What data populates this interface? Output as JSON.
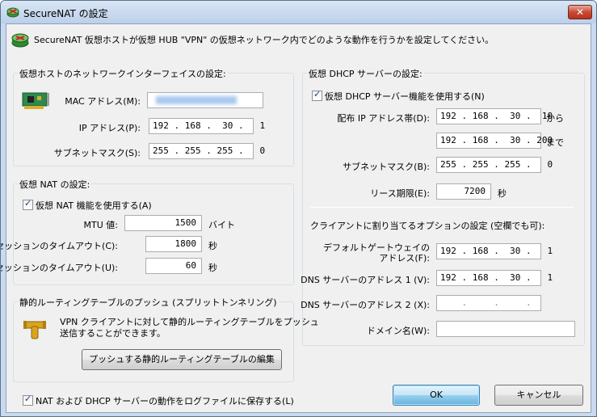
{
  "window": {
    "title": "SecureNAT の設定",
    "close_glyph": "✕"
  },
  "header": {
    "description": "SecureNAT 仮想ホストが仮想 HUB \"VPN\" の仮想ネットワーク内でどのような動作を行うかを設定してください。"
  },
  "host": {
    "group_title": "仮想ホストのネットワークインターフェイスの設定:",
    "mac_label": "MAC アドレス(M):",
    "mac_value": "",
    "ip_label": "IP アドレス(P):",
    "ip_value": "192 . 168 .  30 .   1",
    "mask_label": "サブネットマスク(S):",
    "mask_value": "255 . 255 . 255 .   0"
  },
  "nat": {
    "group_title": "仮想 NAT の設定:",
    "enable_label": "仮想 NAT 機能を使用する(A)",
    "mtu_label": "MTU 値:",
    "mtu_value": "1500",
    "mtu_unit": "バイト",
    "tcp_label": "TCP セッションのタイムアウト(C):",
    "tcp_value": "1800",
    "tcp_unit": "秒",
    "udp_label": "UDP セッションのタイムアウト(U):",
    "udp_value": "60",
    "udp_unit": "秒"
  },
  "routing": {
    "group_title": "静的ルーティングテーブルのプッシュ (スプリットトンネリング)",
    "desc_line1": "VPN クライアントに対して静的ルーティングテーブルをプッシュ",
    "desc_line2": "送信することができます。",
    "edit_button": "プッシュする静的ルーティングテーブルの編集"
  },
  "log": {
    "label": "NAT および DHCP サーバーの動作をログファイルに保存する(L)"
  },
  "dhcp": {
    "group_title": "仮想 DHCP サーバーの設定:",
    "enable_label": "仮想 DHCP サーバー機能を使用する(N)",
    "range_label": "配布 IP アドレス帯(D):",
    "range_start": "192 . 168 .  30 .  10",
    "range_from": "から",
    "range_end": "192 . 168 .  30 . 200",
    "range_to": "まで",
    "mask_label": "サブネットマスク(B):",
    "mask_value": "255 . 255 . 255 .   0",
    "lease_label": "リース期限(E):",
    "lease_value": "7200",
    "lease_unit": "秒",
    "options_title": "クライアントに割り当てるオプションの設定 (空欄でも可):",
    "gw_label1": "デフォルトゲートウェイの",
    "gw_label2": "アドレス(F):",
    "gw_value": "192 . 168 .  30 .   1",
    "dns1_label": "DNS サーバーのアドレス 1 (V):",
    "dns1_value": "192 . 168 .  30 .   1",
    "dns2_label": "DNS サーバーのアドレス 2 (X):",
    "dns2_value": "    .     .     .",
    "domain_label": "ドメイン名(W):",
    "domain_value": ""
  },
  "buttons": {
    "ok": "OK",
    "cancel": "キャンセル"
  },
  "colors": {
    "accent": "#3c7fb1",
    "close": "#c84a35"
  }
}
